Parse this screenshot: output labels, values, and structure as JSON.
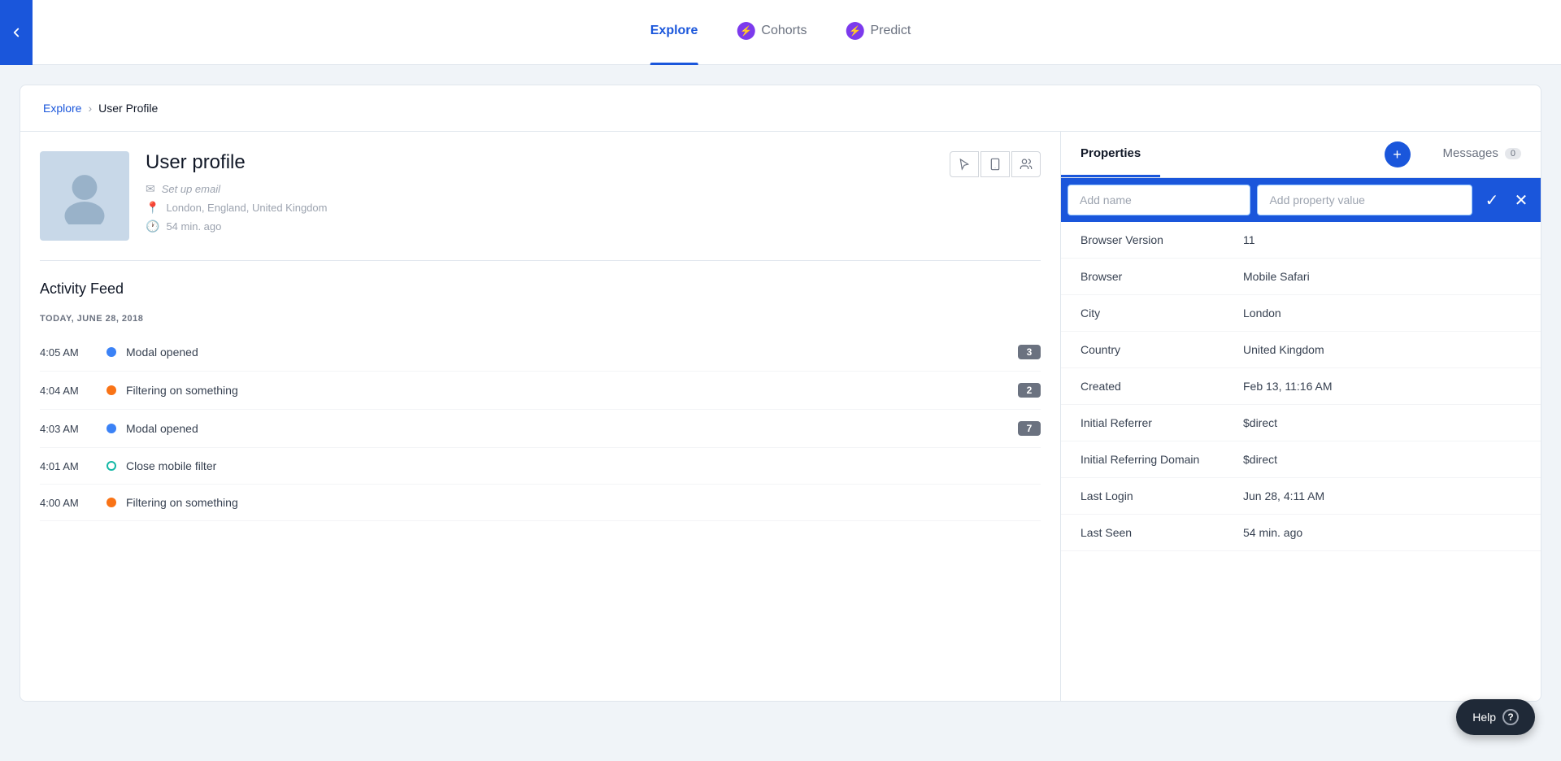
{
  "nav": {
    "tabs": [
      {
        "id": "explore",
        "label": "Explore",
        "active": true,
        "icon": null
      },
      {
        "id": "cohorts",
        "label": "Cohorts",
        "active": false,
        "icon": "⚡",
        "icon_color": "purple"
      },
      {
        "id": "predict",
        "label": "Predict",
        "active": false,
        "icon": "⚡",
        "icon_color": "purple"
      }
    ]
  },
  "breadcrumb": {
    "parent": "Explore",
    "current": "User Profile",
    "chevron": "›"
  },
  "user_profile": {
    "title": "User profile",
    "email_placeholder": "Set up email",
    "location": "London, England, United Kingdom",
    "last_seen": "54 min. ago",
    "actions": [
      "cursor",
      "phone",
      "users"
    ]
  },
  "activity_feed": {
    "title": "Activity Feed",
    "date_header": "TODAY, JUNE 28, 2018",
    "items": [
      {
        "time": "4:05 AM",
        "dot_color": "blue",
        "event": "Modal opened",
        "badge": "3"
      },
      {
        "time": "4:04 AM",
        "dot_color": "orange",
        "event": "Filtering on something",
        "badge": "2"
      },
      {
        "time": "4:03 AM",
        "dot_color": "blue",
        "event": "Modal opened",
        "badge": "7"
      },
      {
        "time": "4:01 AM",
        "dot_color": "teal",
        "event": "Close mobile filter",
        "badge": null
      },
      {
        "time": "4:00 AM",
        "dot_color": "orange",
        "event": "Filtering on something",
        "badge": null
      }
    ]
  },
  "properties_panel": {
    "tabs": [
      {
        "id": "properties",
        "label": "Properties",
        "active": true,
        "badge": null
      },
      {
        "id": "messages",
        "label": "Messages",
        "active": false,
        "badge": "0"
      }
    ],
    "add_name_placeholder": "Add name",
    "add_value_placeholder": "Add property value",
    "properties": [
      {
        "name": "Browser Version",
        "value": "11"
      },
      {
        "name": "Browser",
        "value": "Mobile Safari"
      },
      {
        "name": "City",
        "value": "London"
      },
      {
        "name": "Country",
        "value": "United Kingdom"
      },
      {
        "name": "Created",
        "value": "Feb 13, 11:16 AM"
      },
      {
        "name": "Initial Referrer",
        "value": "$direct"
      },
      {
        "name": "Initial Referring Domain",
        "value": "$direct"
      },
      {
        "name": "Last Login",
        "value": "Jun 28, 4:11 AM"
      },
      {
        "name": "Last Seen",
        "value": "54 min. ago"
      }
    ]
  },
  "help": {
    "label": "Help",
    "icon": "?"
  }
}
